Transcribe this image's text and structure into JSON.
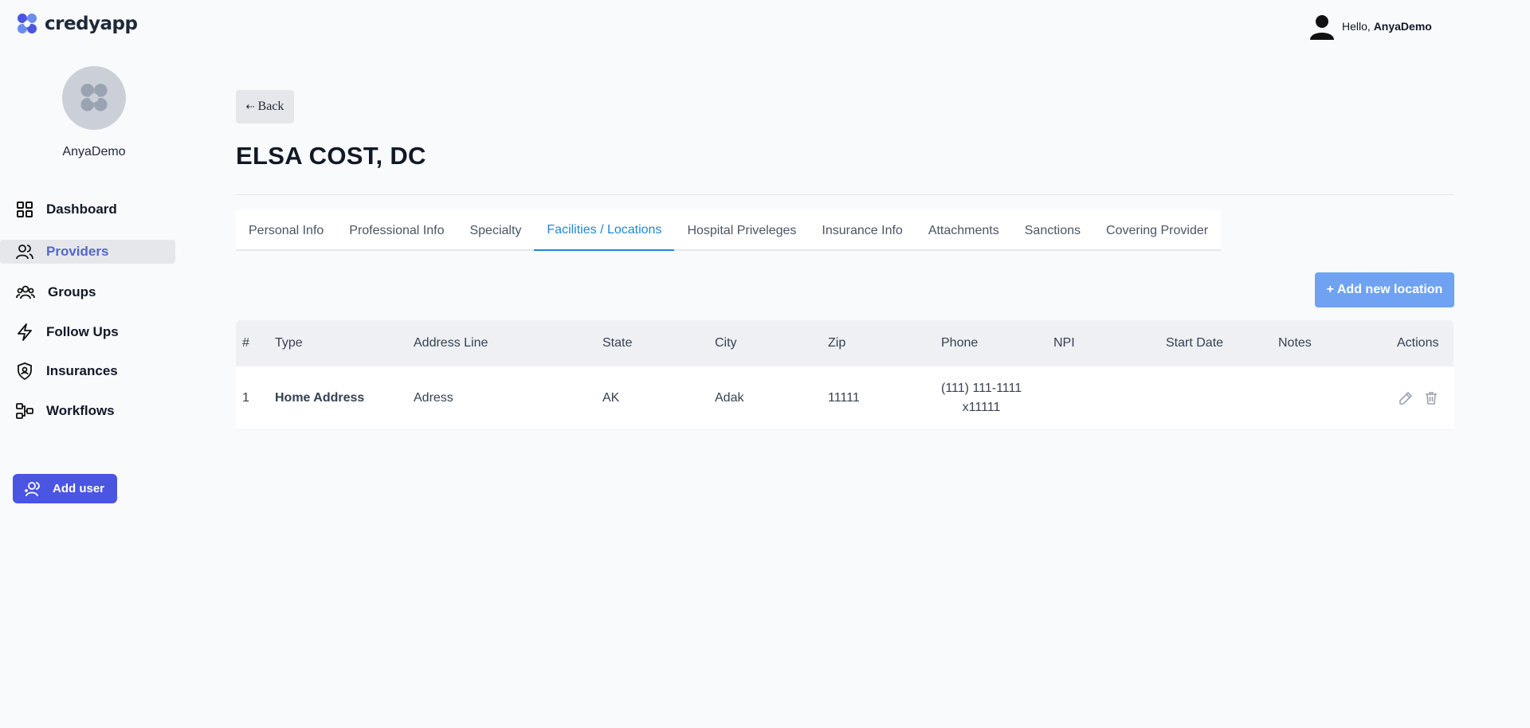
{
  "app": {
    "logo_text": "credyapp",
    "greeting": "Hello,",
    "user_name": "AnyaDemo"
  },
  "sidebar": {
    "profile_name": "AnyaDemo",
    "items": [
      {
        "label": "Dashboard",
        "icon": "grid-icon",
        "active": false
      },
      {
        "label": "Providers",
        "icon": "users-icon",
        "active": true
      },
      {
        "label": "Groups",
        "icon": "group-icon",
        "active": false
      },
      {
        "label": "Follow Ups",
        "icon": "lightning-icon",
        "active": false
      },
      {
        "label": "Insurances",
        "icon": "shield-icon",
        "active": false
      },
      {
        "label": "Workflows",
        "icon": "workflow-icon",
        "active": false
      }
    ],
    "add_user_label": "Add user"
  },
  "page": {
    "back_label": "Back",
    "title": "ELSA COST, DC",
    "tabs": [
      {
        "label": "Personal Info",
        "active": false
      },
      {
        "label": "Professional Info",
        "active": false
      },
      {
        "label": "Specialty",
        "active": false
      },
      {
        "label": "Facilities / Locations",
        "active": true
      },
      {
        "label": "Hospital Priveleges",
        "active": false
      },
      {
        "label": "Insurance Info",
        "active": false
      },
      {
        "label": "Attachments",
        "active": false
      },
      {
        "label": "Sanctions",
        "active": false
      },
      {
        "label": "Covering Provider",
        "active": false
      }
    ],
    "add_location_label": "+ Add new location"
  },
  "table": {
    "headers": [
      "#",
      "Type",
      "Address Line",
      "State",
      "City",
      "Zip",
      "Phone",
      "NPI",
      "Start Date",
      "Notes",
      "Actions"
    ],
    "rows": [
      {
        "num": "1",
        "type": "Home Address",
        "address": "Adress",
        "state": "AK",
        "city": "Adak",
        "zip": "11111",
        "phone_line1": "(111) 111-1111",
        "phone_line2": "x11111",
        "npi": "",
        "start_date": "",
        "notes": ""
      }
    ]
  },
  "colors": {
    "accent": "#4a55e2",
    "active_tab": "#1e88d6",
    "add_location_button": "#6fa2f2",
    "active_nav": "#5467c9"
  }
}
